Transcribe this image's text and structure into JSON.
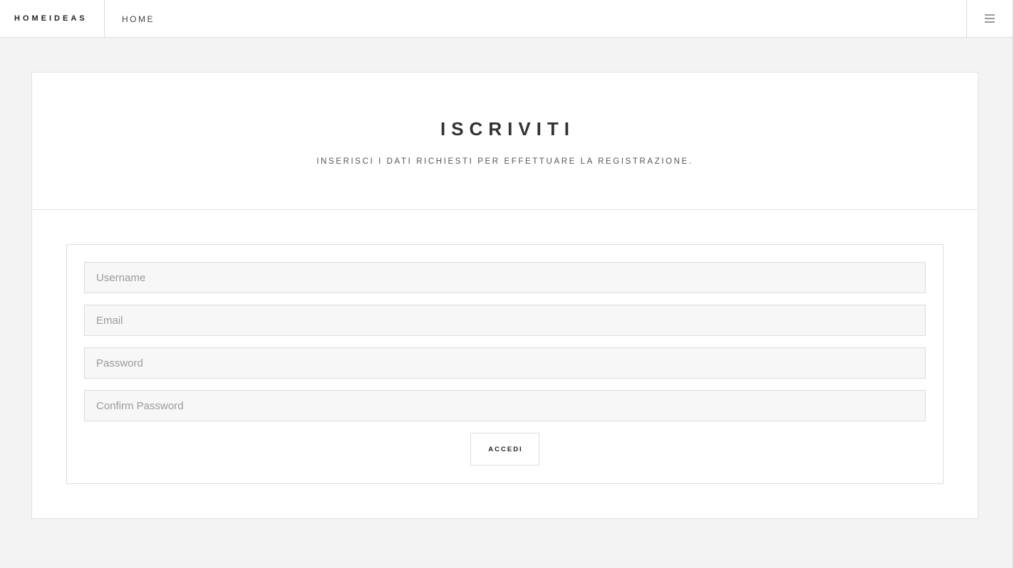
{
  "header": {
    "brand": "HOMEIDEAS",
    "nav_home": "HOME",
    "menu_icon": "hamburger-menu-icon"
  },
  "main": {
    "title": "ISCRIVITI",
    "subtitle": "INSERISCI I DATI RICHIESTI PER EFFETTUARE LA REGISTRAZIONE."
  },
  "form": {
    "username": {
      "placeholder": "Username",
      "value": ""
    },
    "email": {
      "placeholder": "Email",
      "value": ""
    },
    "password": {
      "placeholder": "Password",
      "value": ""
    },
    "confirm_password": {
      "placeholder": "Confirm Password",
      "value": ""
    },
    "submit_label": "ACCEDI"
  },
  "colors": {
    "page_bg": "#f3f3f3",
    "card_bg": "#ffffff",
    "input_bg": "#f7f7f7",
    "border": "#dddddd",
    "text_dark": "#333333"
  }
}
